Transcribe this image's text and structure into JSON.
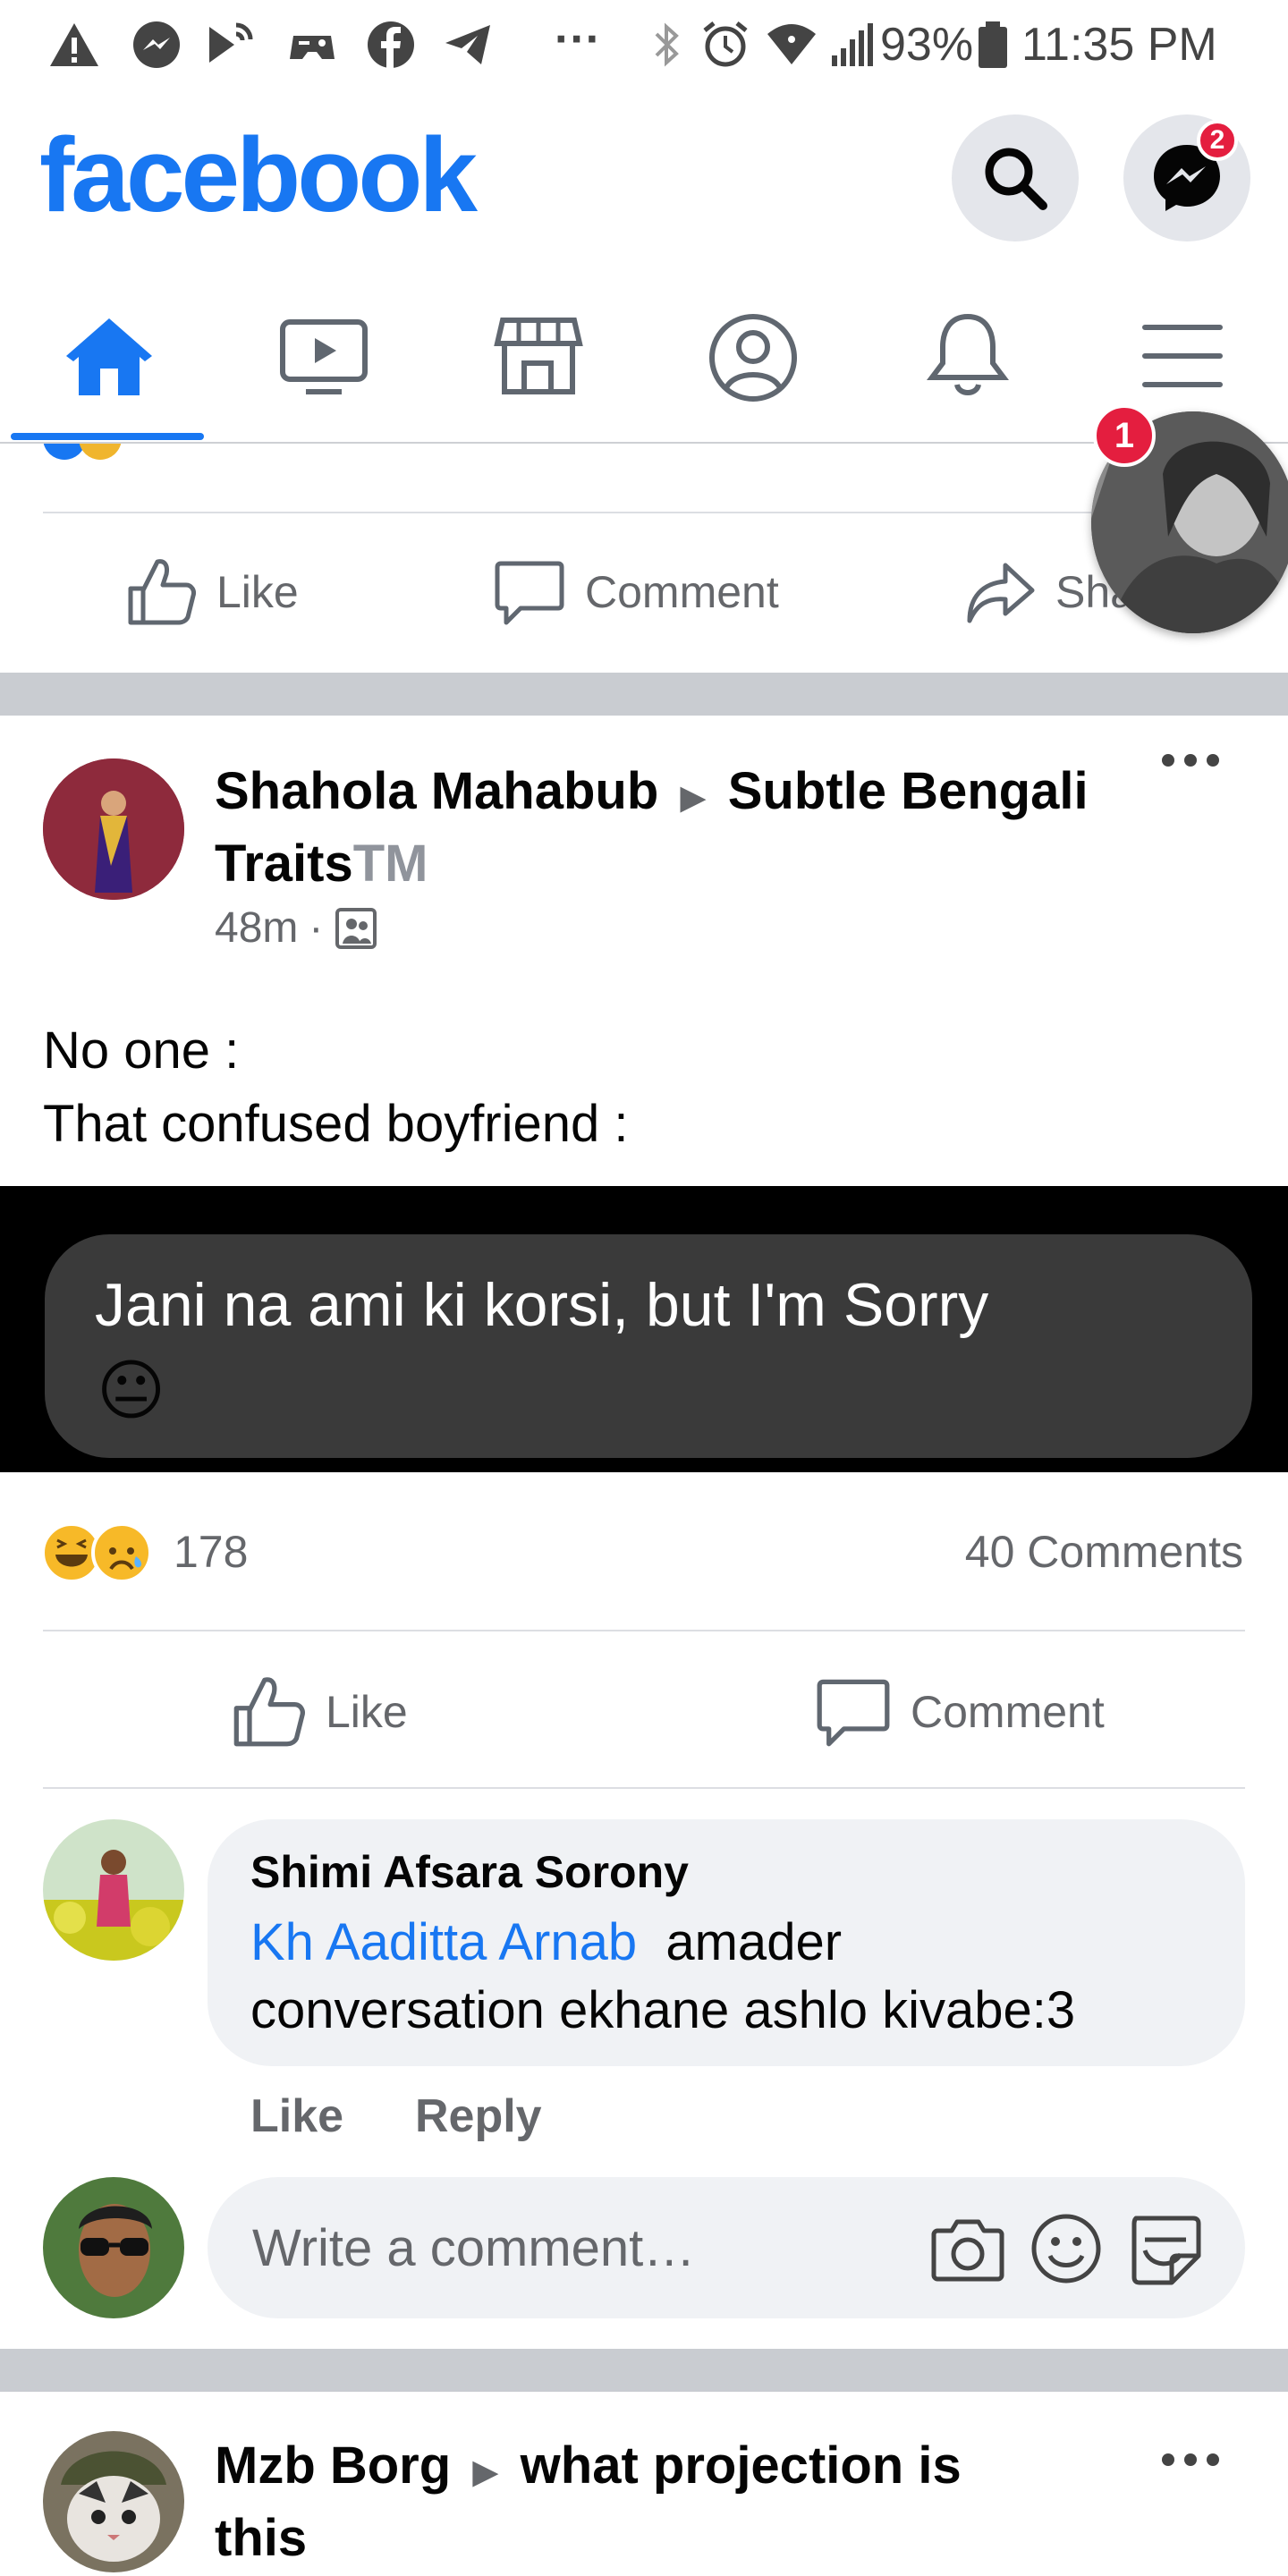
{
  "status_bar": {
    "battery": "93%",
    "time": "11:35 PM",
    "more": "···"
  },
  "header": {
    "logo": "facebook",
    "messenger_badge": "2"
  },
  "chat_head": {
    "badge": "1"
  },
  "post1": {
    "like": "Like",
    "comment": "Comment",
    "share": "Share"
  },
  "post2": {
    "author": "Shahola Mahabub",
    "arrow": "▶",
    "group": "Subtle Bengali Traits",
    "group_tm": "TM",
    "time": "48m",
    "separator": "·",
    "text_line1": "No one :",
    "text_line2": "That confused boyfriend :",
    "image_text": "Jani na ami ki korsi, but I'm Sorry",
    "image_emoji": "😐",
    "reaction_count": "178",
    "comments_count": "40 Comments",
    "like": "Like",
    "comment": "Comment",
    "top_comment": {
      "author": "Shimi Afsara Sorony",
      "mention": "Kh Aaditta Arnab",
      "text_rest": "amader",
      "text_line2": "conversation ekhane ashlo kivabe:3",
      "like": "Like",
      "reply": "Reply"
    },
    "write_comment_placeholder": "Write a comment…"
  },
  "post3": {
    "author": "Mzb Borg",
    "arrow": "▶",
    "group_line1": "what projection is",
    "group_line2": "this"
  },
  "colors": {
    "brand": "#1877f2",
    "badge": "#e41e3f",
    "divider": "#c9ccd1",
    "secondary_text": "#65676b"
  }
}
